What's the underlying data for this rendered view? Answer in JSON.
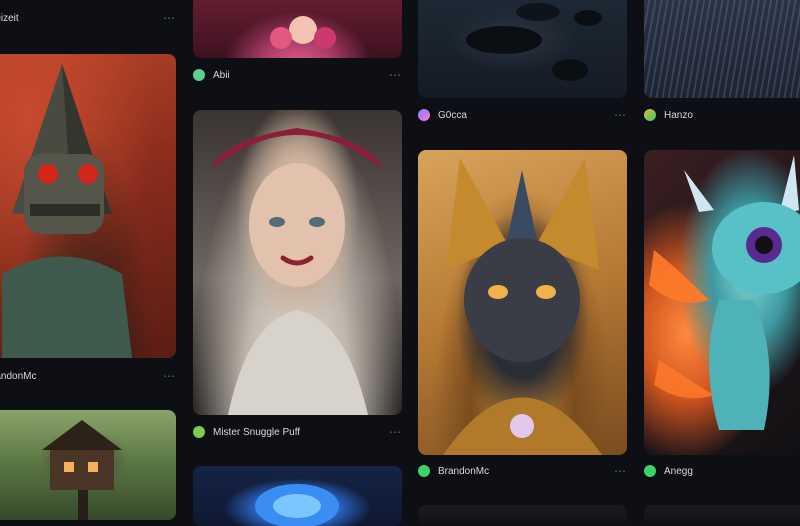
{
  "ui": {
    "more_icon": "⋯"
  },
  "cards": {
    "c0a": {
      "user": "reizeit",
      "avatar_color": "#2ecc71",
      "art": "partial-top"
    },
    "c0b": {
      "user": "randonMc",
      "avatar_color": "#3bd36a",
      "art": "pyramid-skull-figure"
    },
    "c0c": {
      "user": "",
      "avatar_color": "",
      "art": "treehouse"
    },
    "c1a": {
      "user": "Abii",
      "avatar_color": "#5ad08a",
      "art": "flowers-bouquet"
    },
    "c1b": {
      "user": "Mister Snuggle Puff",
      "avatar_color": "#7ccf4a",
      "art": "woman-portrait"
    },
    "c1c": {
      "user": "",
      "avatar_color": "",
      "art": "blue-flower"
    },
    "c2a": {
      "user": "G0cca",
      "avatar_color": "#8a7bff",
      "art": "stones"
    },
    "c2b": {
      "user": "BrandonMc",
      "avatar_color": "#3bd36a",
      "art": "golden-cat"
    },
    "c2c": {
      "user": "",
      "avatar_color": "",
      "art": "dark"
    },
    "c3a": {
      "user": "Hanzo",
      "avatar_color": "#f2b233",
      "art": "frosty-grass"
    },
    "c3b": {
      "user": "Anegg",
      "avatar_color": "#3bd36a",
      "art": "dragon"
    }
  }
}
